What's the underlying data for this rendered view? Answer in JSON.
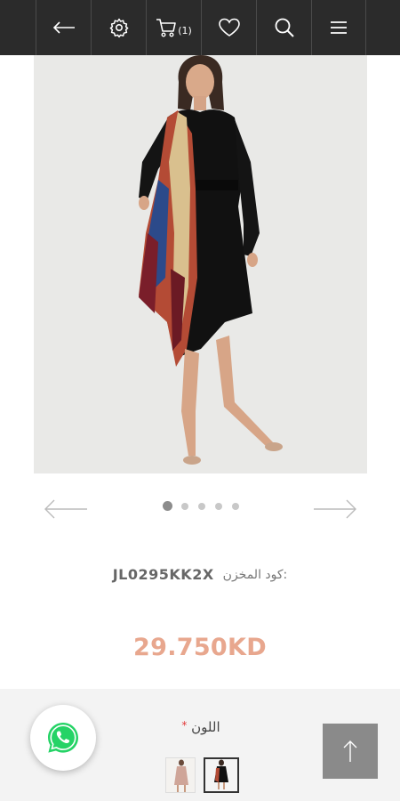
{
  "header": {
    "cart_count": "(1)",
    "icons": [
      "back-arrow-icon",
      "gear-icon",
      "cart-icon",
      "heart-icon",
      "search-icon",
      "menu-icon"
    ]
  },
  "product": {
    "image": "dress-photo",
    "sku_label": "كود المخزن:",
    "sku_value": "JL0295KK2X",
    "price": "29.750KD"
  },
  "carousel": {
    "slide_count": 5,
    "active_index": 0
  },
  "options": {
    "color_label": "اللون",
    "required_mark": "*",
    "swatches": [
      "swatch-nude-dress",
      "swatch-black-dress"
    ],
    "selected_swatch": 1
  },
  "colors": {
    "topbar": "#2b2b2b",
    "price": "#e8a78e",
    "whatsapp": "#25d366",
    "scroll_top": "#8a8a8a"
  }
}
